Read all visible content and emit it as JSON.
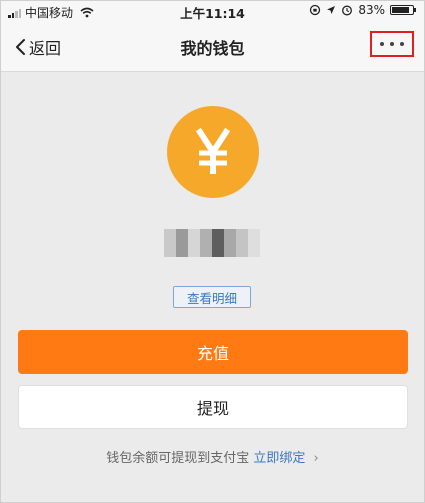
{
  "status_bar": {
    "carrier": "中国移动",
    "time": "上午11:14",
    "battery": "83%",
    "battery_level": 0.83
  },
  "nav": {
    "back_label": "返回",
    "title": "我的钱包",
    "more_label": "···"
  },
  "wallet": {
    "coin_symbol": "¥",
    "detail_label": "查看明细"
  },
  "actions": {
    "recharge_label": "充值",
    "withdraw_label": "提现"
  },
  "footer": {
    "note": "钱包余额可提现到支付宝",
    "bind_label": "立即绑定",
    "chevron": "›"
  },
  "colors": {
    "accent_orange": "#ff7a12",
    "coin": "#f5a82a",
    "link_blue": "#3b78c4",
    "highlight_red": "#e02020"
  }
}
